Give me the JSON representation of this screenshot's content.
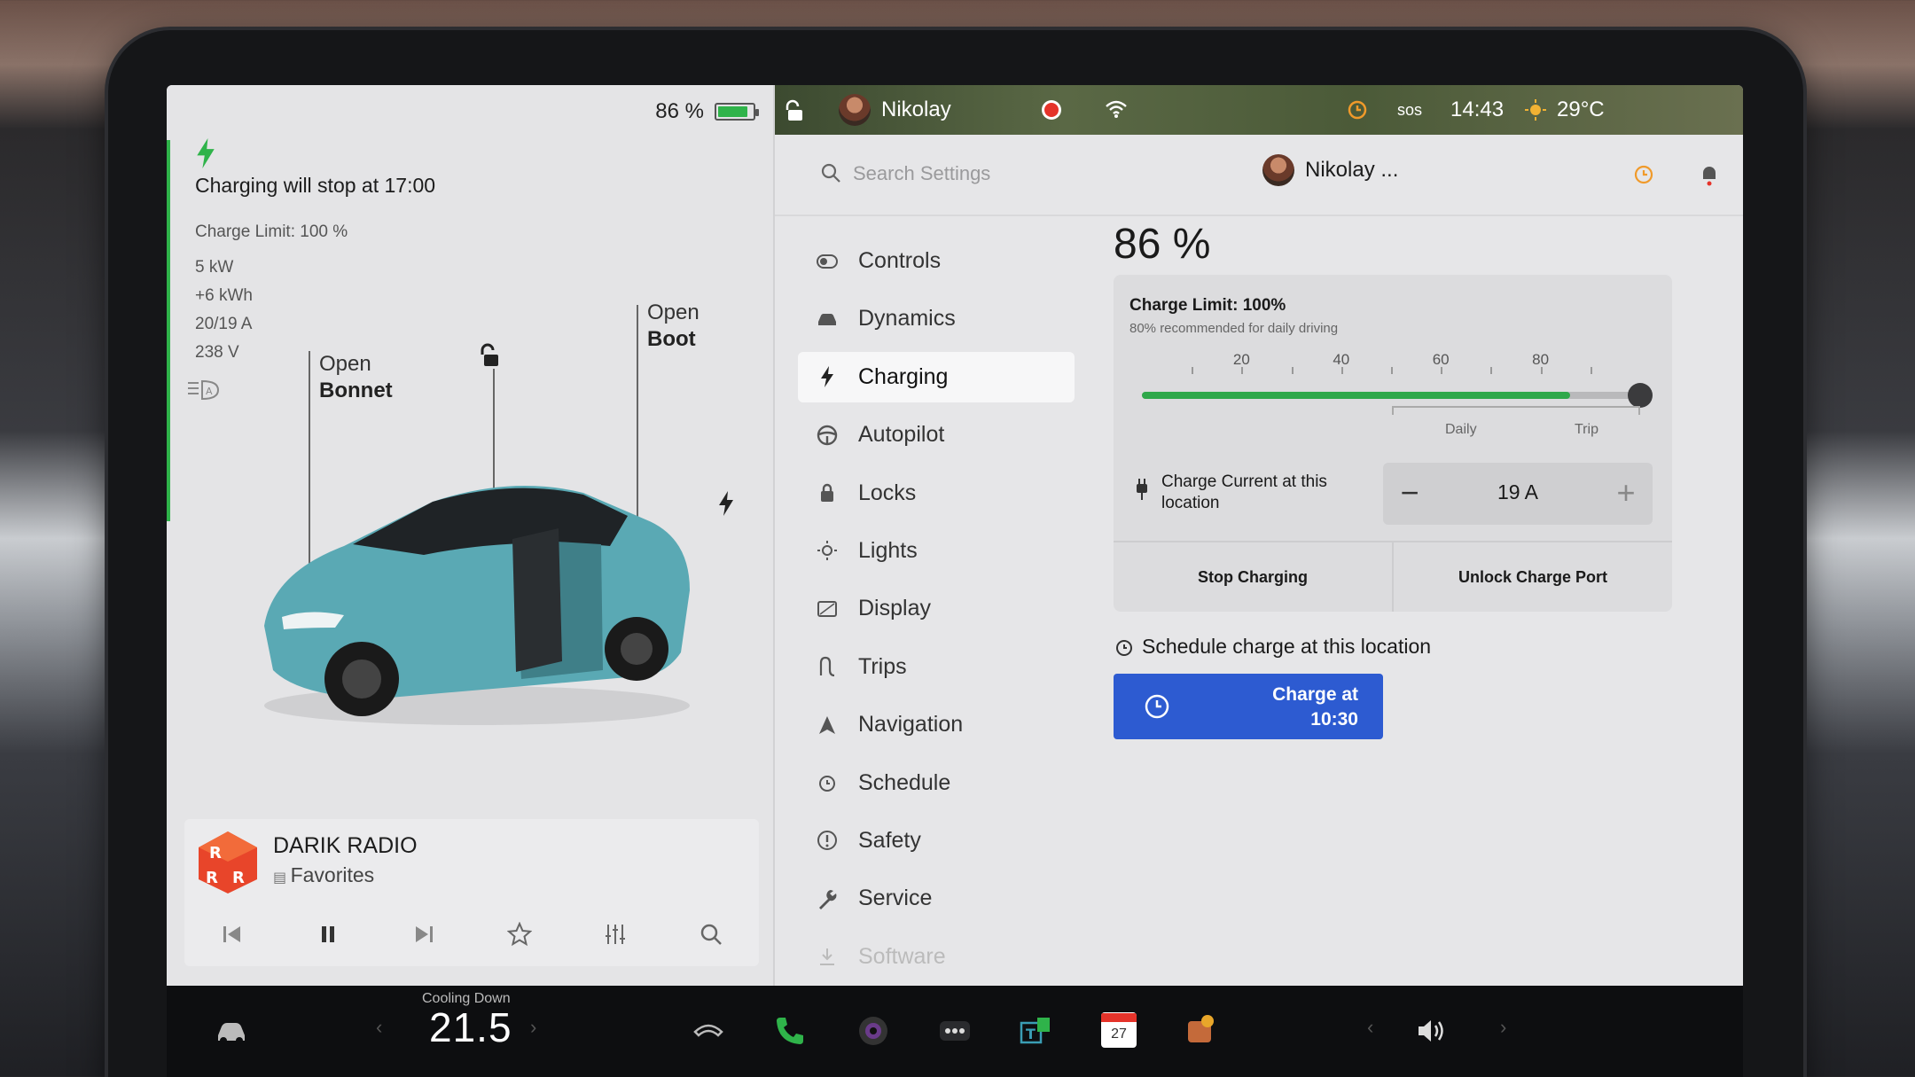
{
  "left_panel": {
    "battery_percent_label": "86 %",
    "battery_level": 0.86,
    "charging_status": "Charging will stop at 17:00",
    "charge_limit_label": "Charge Limit: 100 %",
    "power": "5 kW",
    "energy_added": "+6 kWh",
    "current": "20/19 A",
    "voltage": "238 V",
    "bonnet_action": "Open",
    "bonnet_label": "Bonnet",
    "boot_action": "Open",
    "boot_label": "Boot"
  },
  "media": {
    "station": "DARIK RADIO",
    "source": "Favorites"
  },
  "topbar": {
    "driver_name": "Nikolay",
    "sos": "sos",
    "time": "14:43",
    "temperature": "29°C"
  },
  "settings_header": {
    "search_placeholder": "Search Settings",
    "profile_name": "Nikolay ..."
  },
  "nav": {
    "items": [
      {
        "label": "Controls",
        "icon": "toggle-icon"
      },
      {
        "label": "Dynamics",
        "icon": "car-icon"
      },
      {
        "label": "Charging",
        "icon": "bolt-icon",
        "active": true
      },
      {
        "label": "Autopilot",
        "icon": "steering-wheel-icon"
      },
      {
        "label": "Locks",
        "icon": "lock-icon"
      },
      {
        "label": "Lights",
        "icon": "sun-icon"
      },
      {
        "label": "Display",
        "icon": "display-icon"
      },
      {
        "label": "Trips",
        "icon": "trips-icon"
      },
      {
        "label": "Navigation",
        "icon": "navigation-icon"
      },
      {
        "label": "Schedule",
        "icon": "alarm-icon"
      },
      {
        "label": "Safety",
        "icon": "safety-icon"
      },
      {
        "label": "Service",
        "icon": "wrench-icon"
      },
      {
        "label": "Software",
        "icon": "download-icon"
      }
    ]
  },
  "charging": {
    "battery_percent": "86 %",
    "charge_limit_title": "Charge Limit: 100%",
    "charge_limit_hint": "80% recommended for daily driving",
    "slider_ticks": [
      "20",
      "40",
      "60",
      "80"
    ],
    "charge_limit_value": 100,
    "battery_level_value": 86,
    "daily_label": "Daily",
    "trip_label": "Trip",
    "current_label": "Charge Current at this location",
    "current_value": "19 A",
    "minus_label": "−",
    "plus_label": "+",
    "stop_button": "Stop Charging",
    "unlock_button": "Unlock Charge Port",
    "schedule_title": "Schedule charge at this location",
    "schedule_button_line1": "Charge at",
    "schedule_button_line2": "10:30"
  },
  "dock": {
    "climate_status": "Cooling Down",
    "cabin_temp": "21.5",
    "calendar_day": "27"
  },
  "colors": {
    "accent_green": "#2fb34a",
    "button_blue": "#2d5bd1",
    "recording_red": "#e5332a",
    "alarm_orange": "#f09a2a"
  }
}
